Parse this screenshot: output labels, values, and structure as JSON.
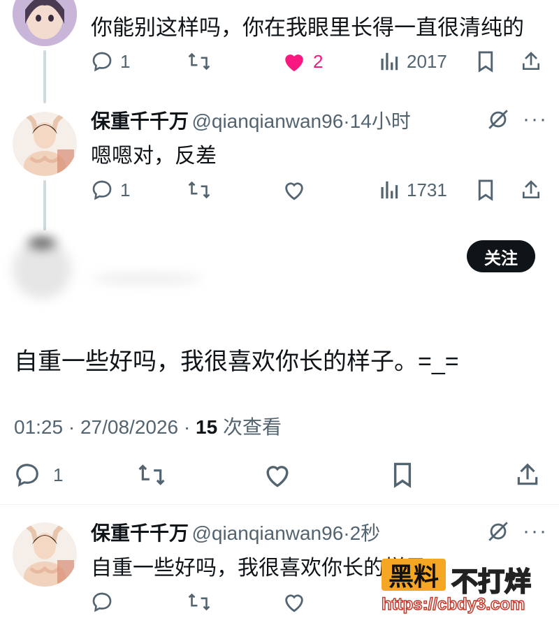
{
  "tweet1": {
    "text": "你能别这样吗，你在我眼里长得一直很清纯的",
    "reply_count": "1",
    "like_count": "2",
    "view_count": "2017"
  },
  "tweet2": {
    "name": "保重千千万",
    "handle": "@qianqianwan96",
    "separator": "·",
    "time": "14小时",
    "text": "嗯嗯对，反差",
    "reply_count": "1",
    "view_count": "1731"
  },
  "main": {
    "follow_label": "关注",
    "text": "自重一些好吗，我很喜欢你长的样子。=_=",
    "time": "01:25",
    "date": "27/08/2026",
    "views": "15",
    "views_suffix": "次查看",
    "reply_count": "1"
  },
  "tweet3": {
    "name": "保重千千万",
    "handle": "@qianqianwan96",
    "separator": "·",
    "time": "2秒",
    "text": "自重一些好吗，我很喜欢你长的样子"
  },
  "watermark": {
    "badge": "黑料",
    "name": "不打烊",
    "url": "https://cbdy3.com"
  },
  "colors": {
    "accent_like": "#f91880",
    "secondary_text": "#536471",
    "primary_text": "#0f1419"
  }
}
